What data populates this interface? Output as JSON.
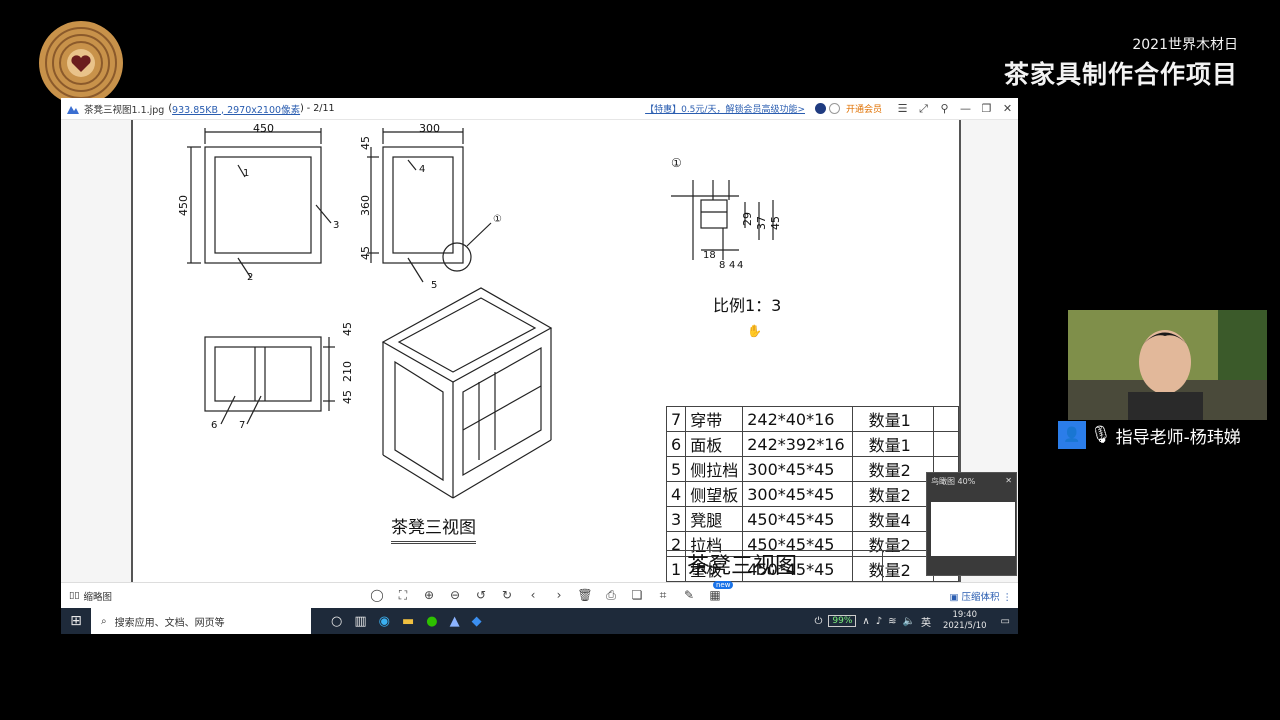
{
  "branding": {
    "subtitle": "2021世界木材日",
    "title": "茶家具制作合作项目"
  },
  "viewer": {
    "file_name": "茶凳三视图1.1.jpg",
    "file_meta": "933.85KB , 2970x2100像素",
    "page_counter": "- 2/11",
    "promo_link": "【特惠】0.5元/天，解锁会员高级功能>",
    "member_button": "开通会员",
    "thumbnails_label": "缩略图",
    "compress_label": "压缩体积",
    "new_badge": "new",
    "navigator_title": "鸟瞰图 40%"
  },
  "drawing": {
    "front_view": {
      "width_dim": "450",
      "height_dim": "450",
      "labels": [
        "1",
        "2",
        "3"
      ]
    },
    "side_view": {
      "width_dim": "300",
      "dims": [
        "45",
        "360",
        "45"
      ],
      "labels": [
        "4",
        "5",
        "①"
      ]
    },
    "top_view": {
      "dims": [
        "45",
        "210",
        "45"
      ],
      "labels": [
        "6",
        "7"
      ]
    },
    "detail": {
      "marker": "①",
      "dims": [
        "29",
        "37",
        "45",
        "18",
        "8",
        "4",
        "4"
      ],
      "scale": "比例1：3"
    },
    "title": "茶凳三视图"
  },
  "parts_table": {
    "rows": [
      {
        "no": "7",
        "name": "穿带",
        "size": "242*40*16",
        "qty": "数量1"
      },
      {
        "no": "6",
        "name": "面板",
        "size": "242*392*16",
        "qty": "数量1"
      },
      {
        "no": "5",
        "name": "侧拉档",
        "size": "300*45*45",
        "qty": "数量2"
      },
      {
        "no": "4",
        "name": "侧望板",
        "size": "300*45*45",
        "qty": "数量2"
      },
      {
        "no": "3",
        "name": "凳腿",
        "size": "450*45*45",
        "qty": "数量4"
      },
      {
        "no": "2",
        "name": "拉档",
        "size": "450*45*45",
        "qty": "数量2"
      },
      {
        "no": "1",
        "name": "望板",
        "size": "450*45*45",
        "qty": "数量2"
      }
    ],
    "title": "茶凳三视图"
  },
  "taskbar": {
    "search_placeholder": "搜索应用、文档、网页等",
    "battery": "99%",
    "ime": "英",
    "time": "19:40",
    "date": "2021/5/10"
  },
  "webcam": {
    "caption": "指导老师-杨玮娣"
  },
  "colors": {
    "accent": "#2b7de9",
    "logo_ring": "#c8924a",
    "logo_heart": "#6b1d1d"
  }
}
